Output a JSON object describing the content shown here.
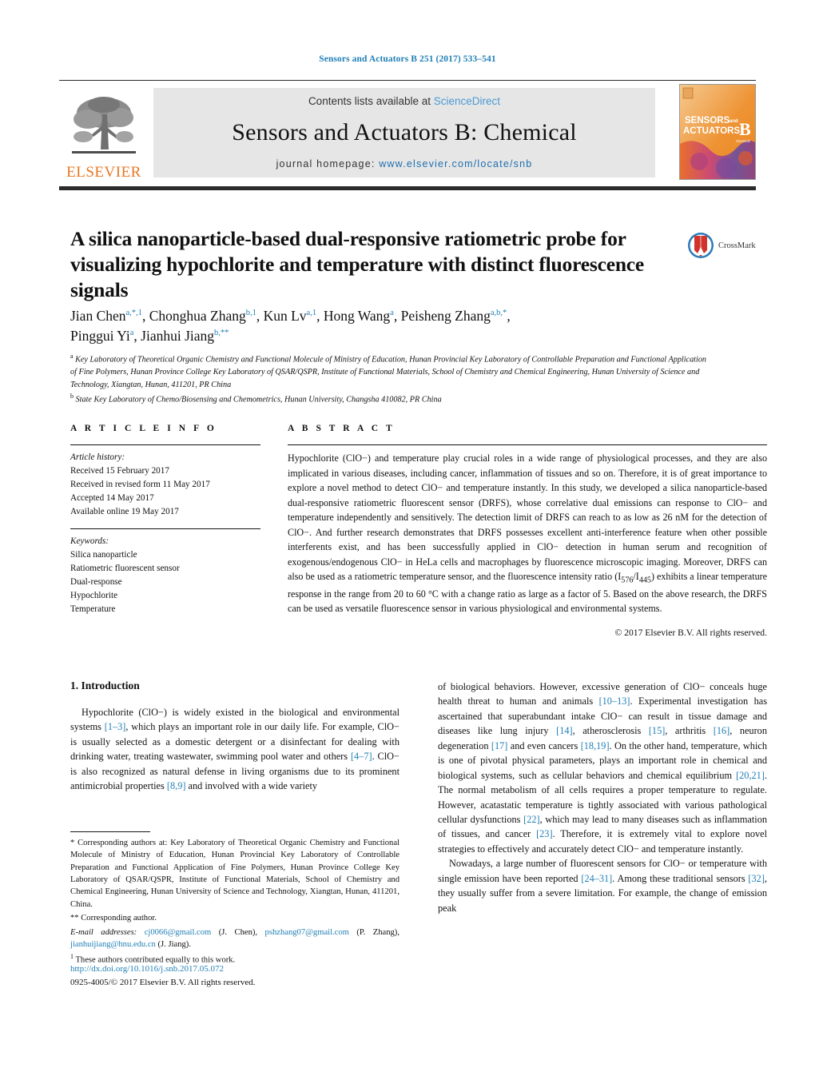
{
  "running_head": "Sensors and Actuators B 251 (2017) 533–541",
  "masthead": {
    "contents_prefix": "Contents lists available at ",
    "sciencedirect": "ScienceDirect",
    "journal_name": "Sensors and Actuators B: Chemical",
    "homepage_prefix": "journal homepage: ",
    "homepage_url": "www.elsevier.com/locate/snb",
    "publisher": "ELSEVIER",
    "cover_title_line1": "SENSORS",
    "cover_title_and": "and",
    "cover_title_line2": "ACTUATORS",
    "cover_letter": "B",
    "accent_blue": "#1f7fb5",
    "elsevier_orange": "#e87722"
  },
  "title": "A silica nanoparticle-based dual-responsive ratiometric probe for visualizing hypochlorite and temperature with distinct fluorescence signals",
  "crossmark_label": "CrossMark",
  "authors_line1": "Jian Chen a,*,1, Chonghua Zhang b,1, Kun Lv a,1, Hong Wang a, Peisheng Zhang a,b,*,",
  "authors_line2": "Pinggui Yi a, Jianhui Jiang b,**",
  "affiliations": [
    "a Key Laboratory of Theoretical Organic Chemistry and Functional Molecule of Ministry of Education, Hunan Provincial Key Laboratory of Controllable Preparation and Functional Application of Fine Polymers, Hunan Province College Key Laboratory of QSAR/QSPR, Institute of Functional Materials, School of Chemistry and Chemical Engineering, Hunan University of Science and Technology, Xiangtan, Hunan, 411201, PR China",
    "b State Key Laboratory of Chemo/Biosensing and Chemometrics, Hunan University, Changsha 410082, PR China"
  ],
  "article_info": {
    "heading": "A R T I C L E   I N F O",
    "history_label": "Article history:",
    "history": [
      "Received 15 February 2017",
      "Received in revised form 11 May 2017",
      "Accepted 14 May 2017",
      "Available online 19 May 2017"
    ],
    "keywords_label": "Keywords:",
    "keywords": [
      "Silica nanoparticle",
      "Ratiometric fluorescent sensor",
      "Dual-response",
      "Hypochlorite",
      "Temperature"
    ]
  },
  "abstract": {
    "heading": "A B S T R A C T",
    "text": "Hypochlorite (ClO−) and temperature play crucial roles in a wide range of physiological processes, and they are also implicated in various diseases, including cancer, inflammation of tissues and so on. Therefore, it is of great importance to explore a novel method to detect ClO− and temperature instantly. In this study, we developed a silica nanoparticle-based dual-responsive ratiometric fluorescent sensor (DRFS), whose correlative dual emissions can response to ClO− and temperature independently and sensitively. The detection limit of DRFS can reach to as low as 26 nM for the detection of ClO−. And further research demonstrates that DRFS possesses excellent anti-interference feature when other possible interferents exist, and has been successfully applied in ClO− detection in human serum and recognition of exogenous/endogenous ClO− in HeLa cells and macrophages by fluorescence microscopic imaging. Moreover, DRFS can also be used as a ratiometric temperature sensor, and the fluorescence intensity ratio (I576/I445) exhibits a linear temperature response in the range from 20 to 60 °C with a change ratio as large as a factor of 5. Based on the above research, the DRFS can be used as versatile fluorescence sensor in various physiological and environmental systems.",
    "copyright": "© 2017 Elsevier B.V. All rights reserved."
  },
  "introduction": {
    "heading": "1.  Introduction",
    "left_para": "Hypochlorite (ClO−) is widely existed in the biological and environmental systems [1–3], which plays an important role in our daily life. For example, ClO− is usually selected as a domestic detergent or a disinfectant for dealing with drinking water, treating wastewater, swimming pool water and others [4–7]. ClO− is also recognized as natural defense in living organisms due to its prominent antimicrobial properties [8,9] and involved with a wide variety",
    "right_para_1": "of biological behaviors. However, excessive generation of ClO− conceals huge health threat to human and animals [10–13]. Experimental investigation has ascertained that superabundant intake ClO− can result in tissue damage and diseases like lung injury [14], atherosclerosis [15], arthritis [16], neuron degeneration [17] and even cancers [18,19]. On the other hand, temperature, which is one of pivotal physical parameters, plays an important role in chemical and biological systems, such as cellular behaviors and chemical equilibrium [20,21]. The normal metabolism of all cells requires a proper temperature to regulate. However, acatastatic temperature is tightly associated with various pathological cellular dysfunctions [22], which may lead to many diseases such as inflammation of tissues, and cancer [23]. Therefore, it is extremely vital to explore novel strategies to effectively and accurately detect ClO− and temperature instantly.",
    "right_para_2": "Nowadays, a large number of fluorescent sensors for ClO− or temperature with single emission have been reported [24–31]. Among these traditional sensors [32], they usually suffer from a severe limitation. For example, the change of emission peak"
  },
  "footnotes": {
    "corresponding_authors": "* Corresponding authors at: Key Laboratory of Theoretical Organic Chemistry and Functional Molecule of Ministry of Education, Hunan Provincial Key Laboratory of Controllable Preparation and Functional Application of Fine Polymers, Hunan Province College Key Laboratory of QSAR/QSPR, Institute of Functional Materials, School of Chemistry and Chemical Engineering, Hunan University of Science and Technology, Xiangtan, Hunan, 411201, China.",
    "corresponding_author_2": "** Corresponding author.",
    "email_label": "E-mail addresses:",
    "email_1": "cj0066@gmail.com",
    "email_1_owner": "(J. Chen),",
    "email_2": "pshzhang07@gmail.com",
    "email_2_owner": "(P. Zhang),",
    "email_3": "jianhuijiang@hnu.edu.cn",
    "email_3_owner": "(J. Jiang).",
    "equal_contribution": "1 These authors contributed equally to this work."
  },
  "footer": {
    "doi": "http://dx.doi.org/10.1016/j.snb.2017.05.072",
    "issn_copyright": "0925-4005/© 2017 Elsevier B.V. All rights reserved."
  }
}
